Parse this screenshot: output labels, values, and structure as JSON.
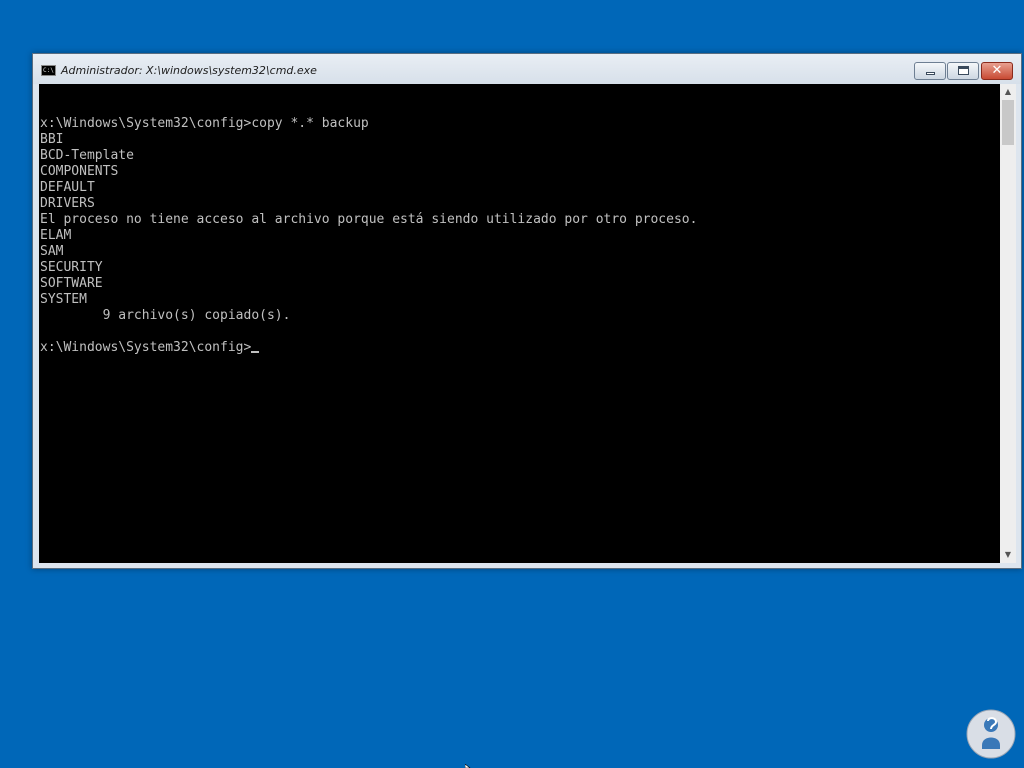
{
  "window": {
    "title": "Administrador: X:\\windows\\system32\\cmd.exe",
    "icon": "cmd-icon",
    "icon_text": "C:\\"
  },
  "console": {
    "lines": [
      "",
      "x:\\Windows\\System32\\config>copy *.* backup",
      "BBI",
      "BCD-Template",
      "COMPONENTS",
      "DEFAULT",
      "DRIVERS",
      "El proceso no tiene acceso al archivo porque está siendo utilizado por otro proceso.",
      "ELAM",
      "SAM",
      "SECURITY",
      "SOFTWARE",
      "SYSTEM",
      "        9 archivo(s) copiado(s).",
      "",
      "x:\\Windows\\System32\\config>"
    ],
    "text_color": "#c0c0c0",
    "background": "#000000"
  },
  "colors": {
    "desktop": "#0067b8",
    "close_button": "#c84a34"
  },
  "icons": {
    "minimize": "minimize-icon",
    "maximize": "maximize-icon",
    "close": "close-icon",
    "scroll_up": "chevron-up-icon",
    "scroll_down": "chevron-down-icon",
    "logo": "help-person-logo",
    "mouse": "mouse-pointer-icon"
  }
}
